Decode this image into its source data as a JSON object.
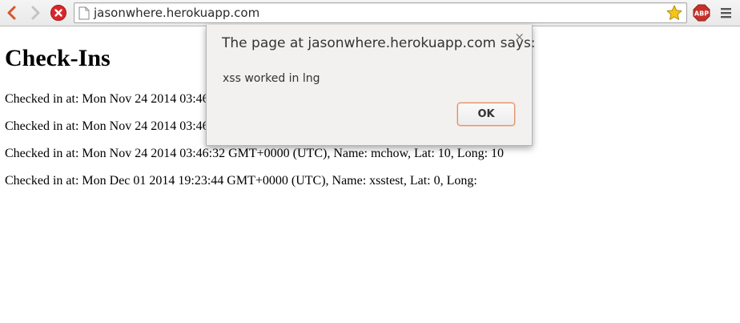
{
  "browser": {
    "url": "jasonwhere.herokuapp.com",
    "icons": {
      "back": "chevron-left-icon",
      "forward": "chevron-right-icon",
      "stop": "stop-icon",
      "page": "page-icon",
      "bookmark": "star-icon",
      "extension": "adblock-plus-icon",
      "menu": "hamburger-menu-icon"
    },
    "extension_label": "ABP",
    "colors": {
      "back_arrow": "#d8562c",
      "stop": "#d8262a",
      "star": "#f5c518",
      "abp": "#c7302a"
    }
  },
  "page": {
    "title": "Check-Ins",
    "checkins": [
      "Checked in at: Mon Nov 24 2014 03:46",
      "Checked in at: Mon Nov 24 2014 03:46",
      "Checked in at: Mon Nov 24 2014 03:46:32 GMT+0000 (UTC), Name: mchow, Lat: 10, Long: 10",
      "Checked in at: Mon Dec 01 2014 19:23:44 GMT+0000 (UTC), Name: xsstest, Lat: 0, Long:"
    ]
  },
  "dialog": {
    "title": "The page at jasonwhere.herokuapp.com says:",
    "message": "xss worked in lng",
    "ok_label": "OK",
    "close_label": "×"
  }
}
